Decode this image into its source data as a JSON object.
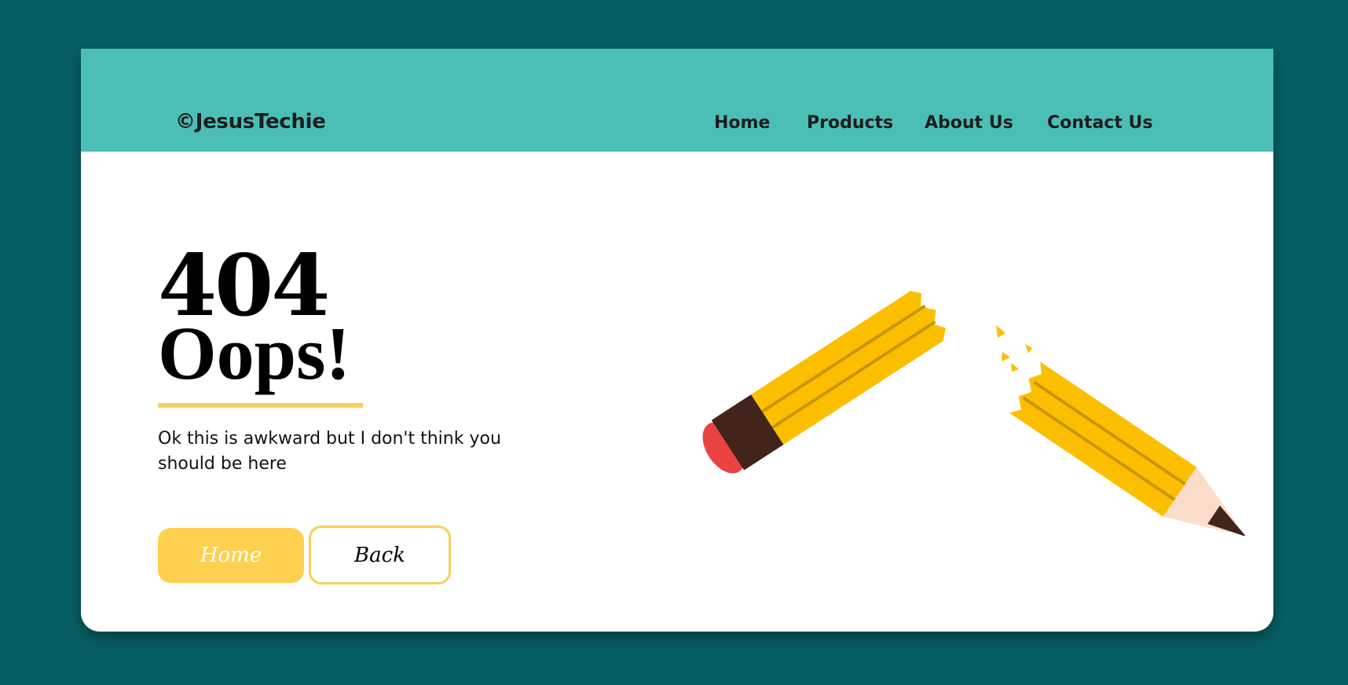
{
  "header": {
    "brand": "©JesusTechie",
    "nav": [
      {
        "label": "Home"
      },
      {
        "label": "Products"
      },
      {
        "label": "About Us"
      },
      {
        "label": "Contact Us"
      }
    ]
  },
  "main": {
    "code": "404",
    "headline": "Oops!",
    "message": "Ok this is awkward but I don't think you should be here",
    "buttons": {
      "home_label": "Home",
      "back_label": "Back"
    }
  },
  "colors": {
    "page_background": "#075f63",
    "header_background": "#4bbfb6",
    "accent_yellow": "#fdd04f",
    "pencil_yellow": "#fbbf00",
    "eraser_red": "#eb4242",
    "ferrule_brown": "#42241a"
  },
  "illustration": {
    "icon": "broken-pencil-icon"
  }
}
